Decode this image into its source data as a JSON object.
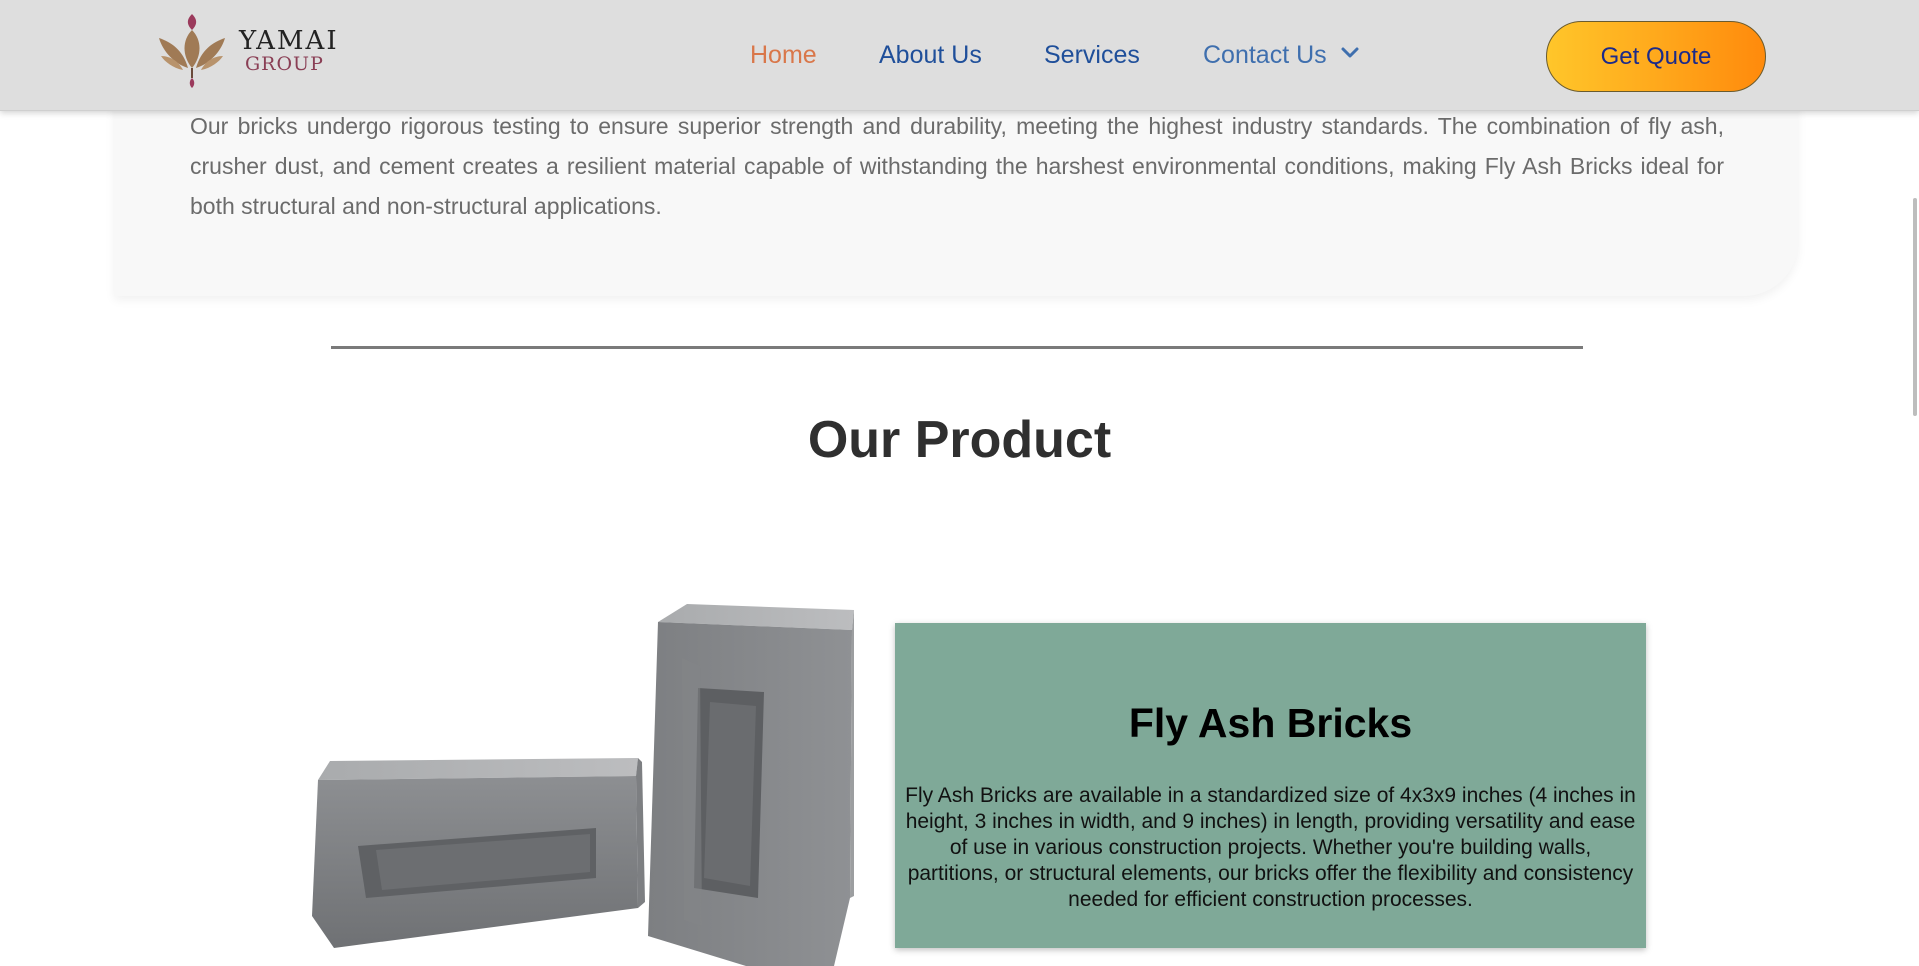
{
  "header": {
    "logo": {
      "word": "YAMAI",
      "sub": "GROUP"
    },
    "nav": [
      {
        "label": "Home",
        "active": true
      },
      {
        "label": "About Us"
      },
      {
        "label": "Services"
      },
      {
        "label": "Contact Us",
        "icon": "chevron-down-icon"
      }
    ],
    "cta_label": "Get Quote",
    "colors": {
      "header_bg": "#dedede",
      "nav_active": "#d9774a",
      "nav_link": "#1f4f9a",
      "cta_gradient_start": "#ffc62a",
      "cta_gradient_end": "#ff8a0c"
    }
  },
  "intro": {
    "text": "Our bricks undergo rigorous testing to ensure superior strength and durability, meeting the highest industry standards. The combination of fly ash, crusher dust, and cement creates a resilient material capable of withstanding the harshest environmental conditions, making Fly Ash Bricks ideal for both structural and non-structural applications."
  },
  "section": {
    "title": "Our Product"
  },
  "product": {
    "image": "fly-ash-bricks-image",
    "title": "Fly Ash Bricks",
    "description": "Fly Ash Bricks are available in a standardized size of 4x3x9 inches (4 inches in height, 3 inches in width, and 9 inches) in length, providing versatility and ease of use in various construction projects. Whether you're building walls, partitions, or structural elements, our bricks offer the flexibility and consistency needed for efficient construction processes.",
    "card_color": "#7fa998"
  }
}
